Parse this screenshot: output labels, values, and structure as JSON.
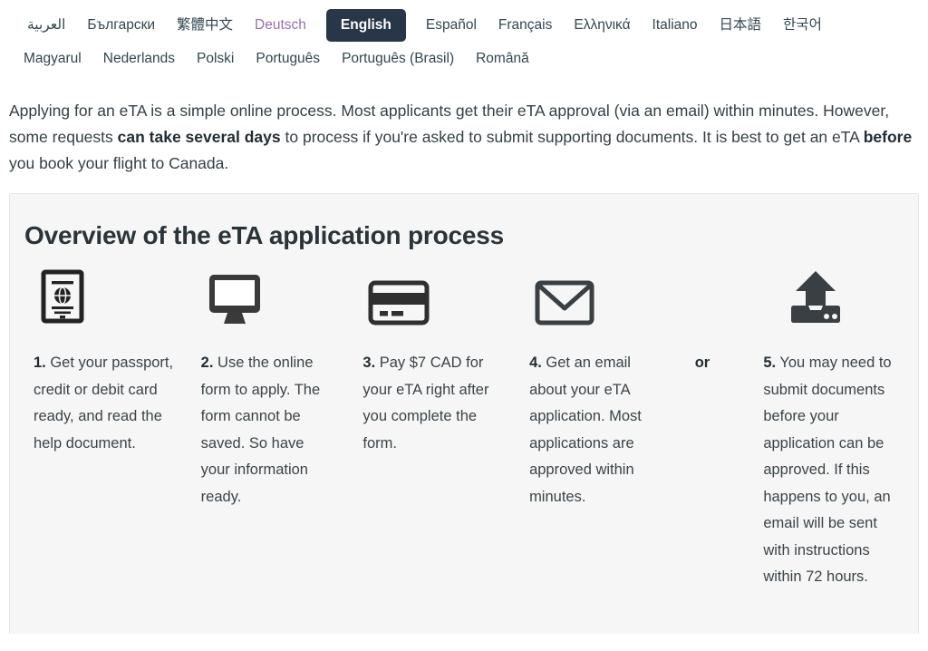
{
  "language_bar": {
    "row1": [
      {
        "label": "العربية",
        "state": "normal",
        "name": "lang-link-arabic"
      },
      {
        "label": "Български",
        "state": "normal",
        "name": "lang-link-bulgarian"
      },
      {
        "label": "繁體中文",
        "state": "normal",
        "name": "lang-link-chinese-traditional"
      },
      {
        "label": "Deutsch",
        "state": "visited",
        "name": "lang-link-german"
      },
      {
        "label": "English",
        "state": "active",
        "name": "lang-link-english"
      },
      {
        "label": "Español",
        "state": "normal",
        "name": "lang-link-spanish"
      },
      {
        "label": "Français",
        "state": "normal",
        "name": "lang-link-french"
      },
      {
        "label": "Ελληνικά",
        "state": "normal",
        "name": "lang-link-greek"
      },
      {
        "label": "Italiano",
        "state": "normal",
        "name": "lang-link-italian"
      },
      {
        "label": "日本語",
        "state": "normal",
        "name": "lang-link-japanese"
      },
      {
        "label": "한국어",
        "state": "normal",
        "name": "lang-link-korean"
      }
    ],
    "row2": [
      {
        "label": "Magyarul",
        "state": "normal",
        "name": "lang-link-hungarian"
      },
      {
        "label": "Nederlands",
        "state": "normal",
        "name": "lang-link-dutch"
      },
      {
        "label": "Polski",
        "state": "normal",
        "name": "lang-link-polish"
      },
      {
        "label": "Português",
        "state": "normal",
        "name": "lang-link-portuguese"
      },
      {
        "label": "Português (Brasil)",
        "state": "normal",
        "name": "lang-link-portuguese-brazil"
      },
      {
        "label": "Română",
        "state": "normal",
        "name": "lang-link-romanian"
      }
    ],
    "active_language": "English",
    "active_bg_color": "#283747",
    "visited_link_color": "#9b6fb0",
    "link_color": "#33474f"
  },
  "intro": {
    "part1": "Applying for an eTA is a simple online process. Most applicants get their eTA approval (via an email) within minutes. However, some requests ",
    "bold1": "can take several days",
    "part2": " to process if you're asked to submit supporting documents. It is best to get an eTA ",
    "bold2": "before",
    "part3": " you book your flight to Canada."
  },
  "panel": {
    "title": "Overview of the eTA application process",
    "background_color": "#f6f6f6",
    "border_color": "#e6e6e6",
    "or_label": "or",
    "steps": [
      {
        "number": "1.",
        "text": " Get your passport, credit or debit card ready, and read the help document.",
        "icon": "passport-icon"
      },
      {
        "number": "2.",
        "text": " Use the online form to apply. The form cannot be saved. So have your information ready.",
        "icon": "desktop-monitor-icon"
      },
      {
        "number": "3.",
        "text": " Pay $7 CAD for your eTA right after you complete the form.",
        "icon": "credit-card-icon"
      },
      {
        "number": "4.",
        "text": " Get an email about your eTA application. Most applications are approved within minutes.",
        "icon": "envelope-icon"
      },
      {
        "number": "5.",
        "text": " You may need to submit documents before your application can be approved. If this happens to you, an email will be sent with instructions within 72 hours.",
        "icon": "upload-icon"
      }
    ]
  }
}
